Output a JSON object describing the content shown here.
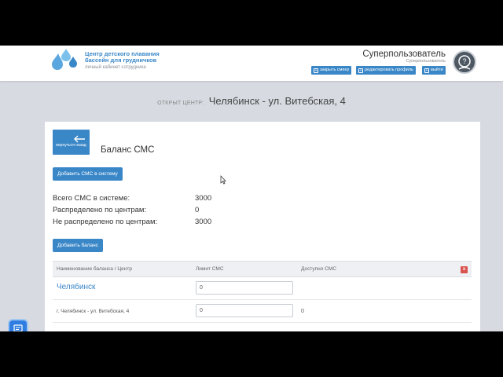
{
  "brand": {
    "line1": "Центр детского плавания",
    "line2": "бассейн для грудничков",
    "subtitle": "личный кабинет сотрудника"
  },
  "user": {
    "name": "Суперпользователь",
    "role": "Суперпользователь",
    "buttons": {
      "close_shift": "закрыть смену",
      "edit_profile": "редактировать профиль",
      "logout": "выйти"
    }
  },
  "center": {
    "label": "ОТКРЫТ ЦЕНТР:",
    "name": "Челябинск - ул. Витебская, 4"
  },
  "page": {
    "back_label": "вернуться назад",
    "title": "Баланс СМС",
    "add_sms_button": "Добавить СМС в систему",
    "add_balance_button": "Добавить баланс"
  },
  "stats": [
    {
      "label": "Всего СМС в системе:",
      "value": "3000"
    },
    {
      "label": "Распределено по центрам:",
      "value": "0"
    },
    {
      "label": "Не распределено по центрам:",
      "value": "3000"
    }
  ],
  "table": {
    "headers": [
      "Наименование баланса / Центр",
      "Лимит СМС",
      "Доступно СМС"
    ],
    "delete_label": "x",
    "balance": {
      "name": "Челябинск",
      "limit": "0"
    },
    "branches": [
      {
        "name": "г. Челябинск - ул. Витебская, 4",
        "limit": "0",
        "available": "0"
      }
    ]
  },
  "colors": {
    "accent": "#3a87c8",
    "danger": "#d9534f",
    "background": "#d7dbe1"
  }
}
